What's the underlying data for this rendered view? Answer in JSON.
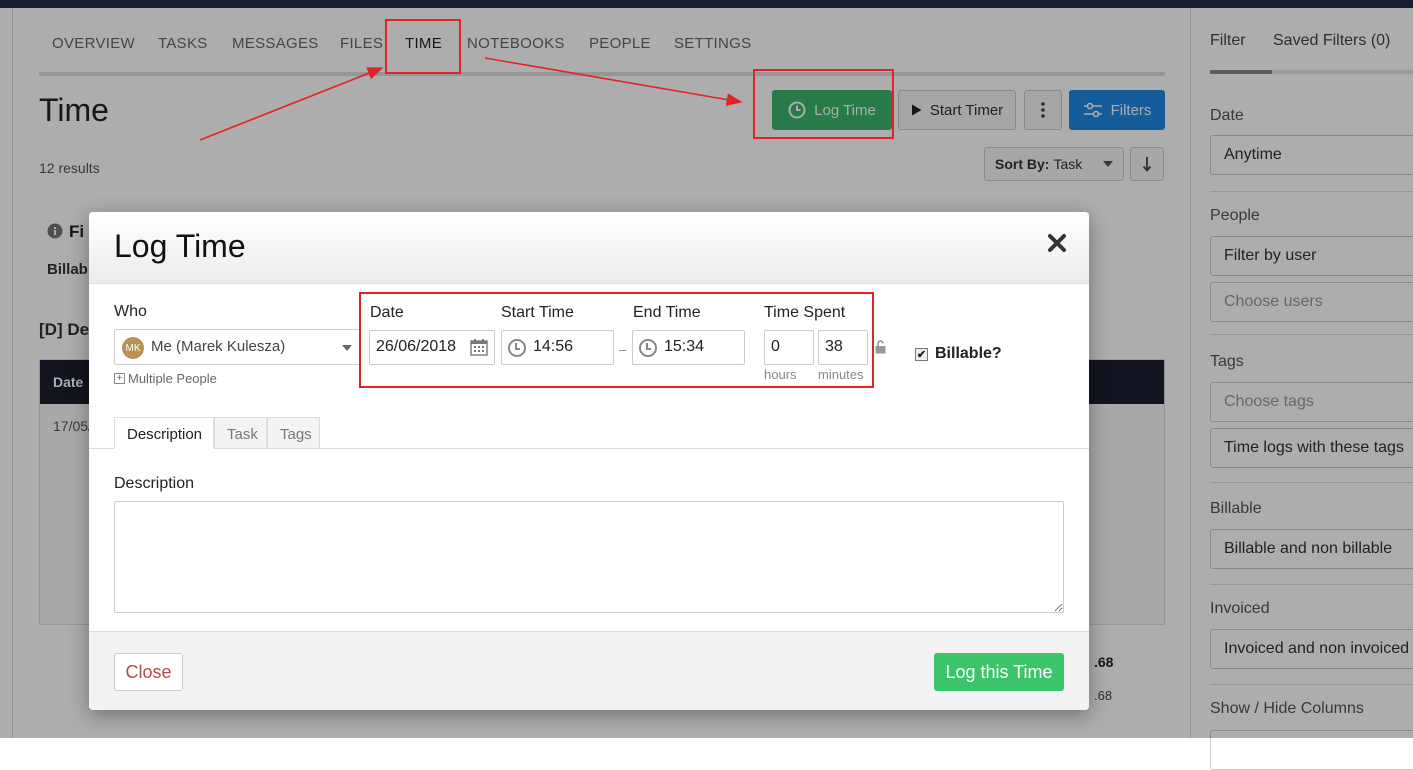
{
  "tabs": [
    "OVERVIEW",
    "TASKS",
    "MESSAGES",
    "FILES",
    "TIME",
    "NOTEBOOKS",
    "PEOPLE",
    "SETTINGS"
  ],
  "header": {
    "title": "Time",
    "results": "12 results",
    "log_time": "Log Time",
    "start_timer": "Start Timer",
    "filters": "Filters",
    "sort_by_label": "Sort By:",
    "sort_by_value": "Task"
  },
  "background": {
    "info_heading": "Fi",
    "billable_prefix": "Billab",
    "section_heading": "[D] De",
    "table_header_date": "Date",
    "first_date": "17/05/",
    "total_1": ".68",
    "total_2": ".68"
  },
  "sidebar": {
    "tab_filter": "Filter",
    "tab_saved": "Saved Filters (0)",
    "date_label": "Date",
    "date_value": "Anytime",
    "people_label": "People",
    "people_value": "Filter by user",
    "people_placeholder": "Choose users",
    "tags_label": "Tags",
    "tags_placeholder": "Choose tags",
    "tags_mode": "Time logs with these tags",
    "billable_label": "Billable",
    "billable_value": "Billable and non billable",
    "invoiced_label": "Invoiced",
    "invoiced_value": "Invoiced and non invoiced",
    "columns_label": "Show / Hide Columns"
  },
  "modal": {
    "title": "Log Time",
    "who_label": "Who",
    "who_value": "Me (Marek Kulesza)",
    "who_initials": "MK",
    "multiple_people": "Multiple People",
    "date_label": "Date",
    "date_value": "26/06/2018",
    "start_label": "Start Time",
    "start_value": "14:56",
    "end_label": "End Time",
    "end_value": "15:34",
    "spent_label": "Time Spent",
    "hours_value": "0",
    "minutes_value": "38",
    "hours_label": "hours",
    "minutes_label": "minutes",
    "billable_label": "Billable?",
    "tabs": [
      "Description",
      "Task",
      "Tags"
    ],
    "description_label": "Description",
    "close": "Close",
    "submit": "Log this Time"
  },
  "colors": {
    "green": "#3cb46a",
    "blue": "#1f88e5",
    "annotation_red": "#e02424",
    "dark_header": "#1b1e2e"
  }
}
